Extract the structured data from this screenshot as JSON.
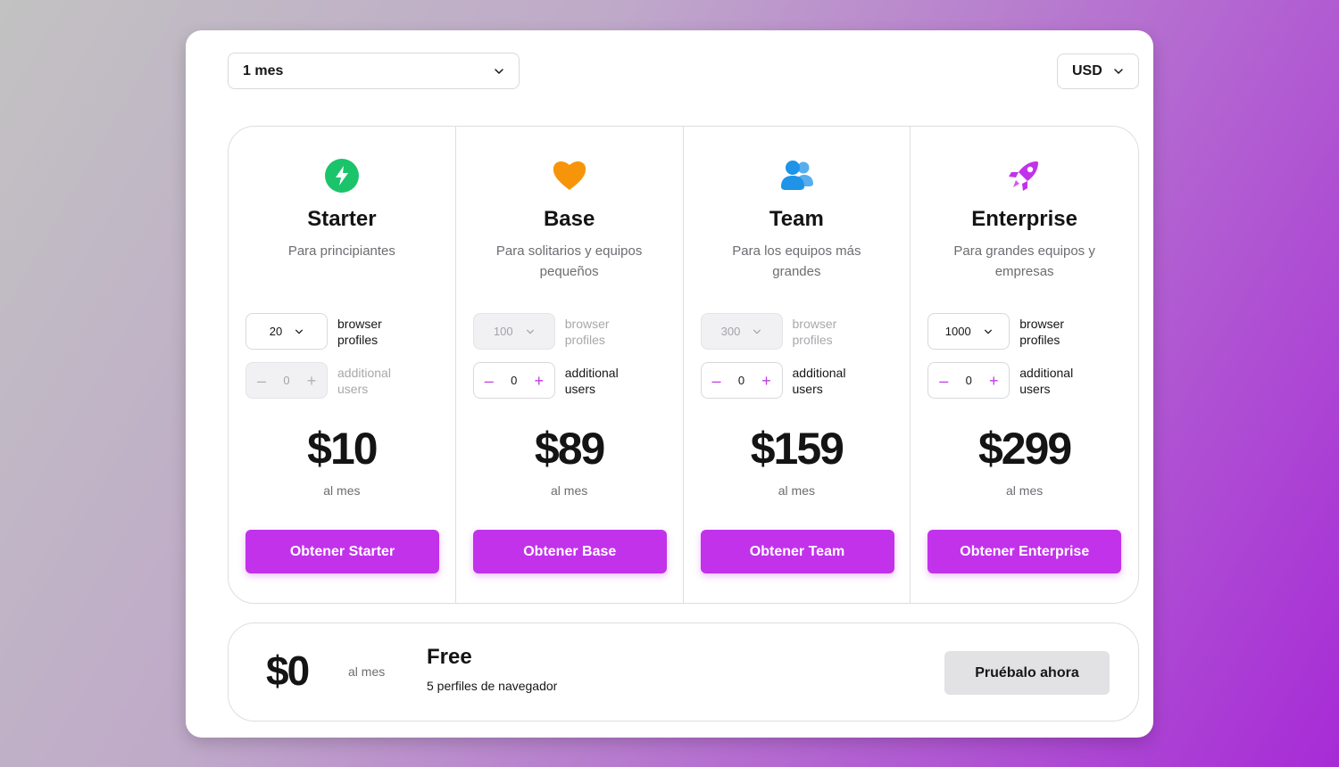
{
  "period_select": {
    "value": "1 mes"
  },
  "currency_select": {
    "value": "USD"
  },
  "per_period_label": "al mes",
  "browser_profiles_label": "browser profiles",
  "additional_users_label": "additional users",
  "colors": {
    "accent": "#c232eb",
    "starter_icon": "#1bc46b",
    "base_icon": "#f7950a",
    "team_icon": "#1e93e8",
    "enterprise_icon": "#c232eb"
  },
  "plans": [
    {
      "icon": "lightning-icon",
      "name": "Starter",
      "desc": "Para principiantes",
      "profiles": "20",
      "profiles_disabled": false,
      "users": "0",
      "users_disabled": true,
      "price": "$10",
      "cta": "Obtener Starter"
    },
    {
      "icon": "heart-icon",
      "name": "Base",
      "desc": "Para solitarios y equipos pequeños",
      "profiles": "100",
      "profiles_disabled": true,
      "users": "0",
      "users_disabled": false,
      "price": "$89",
      "cta": "Obtener Base"
    },
    {
      "icon": "users-icon",
      "name": "Team",
      "desc": "Para los equipos más grandes",
      "profiles": "300",
      "profiles_disabled": true,
      "users": "0",
      "users_disabled": false,
      "price": "$159",
      "cta": "Obtener Team"
    },
    {
      "icon": "rocket-icon",
      "name": "Enterprise",
      "desc": "Para grandes equipos y empresas",
      "profiles": "1000",
      "profiles_disabled": false,
      "users": "0",
      "users_disabled": false,
      "price": "$299",
      "cta": "Obtener Enterprise"
    }
  ],
  "free": {
    "price": "$0",
    "per": "al mes",
    "name": "Free",
    "desc": "5 perfiles de navegador",
    "cta": "Pruébalo ahora"
  }
}
